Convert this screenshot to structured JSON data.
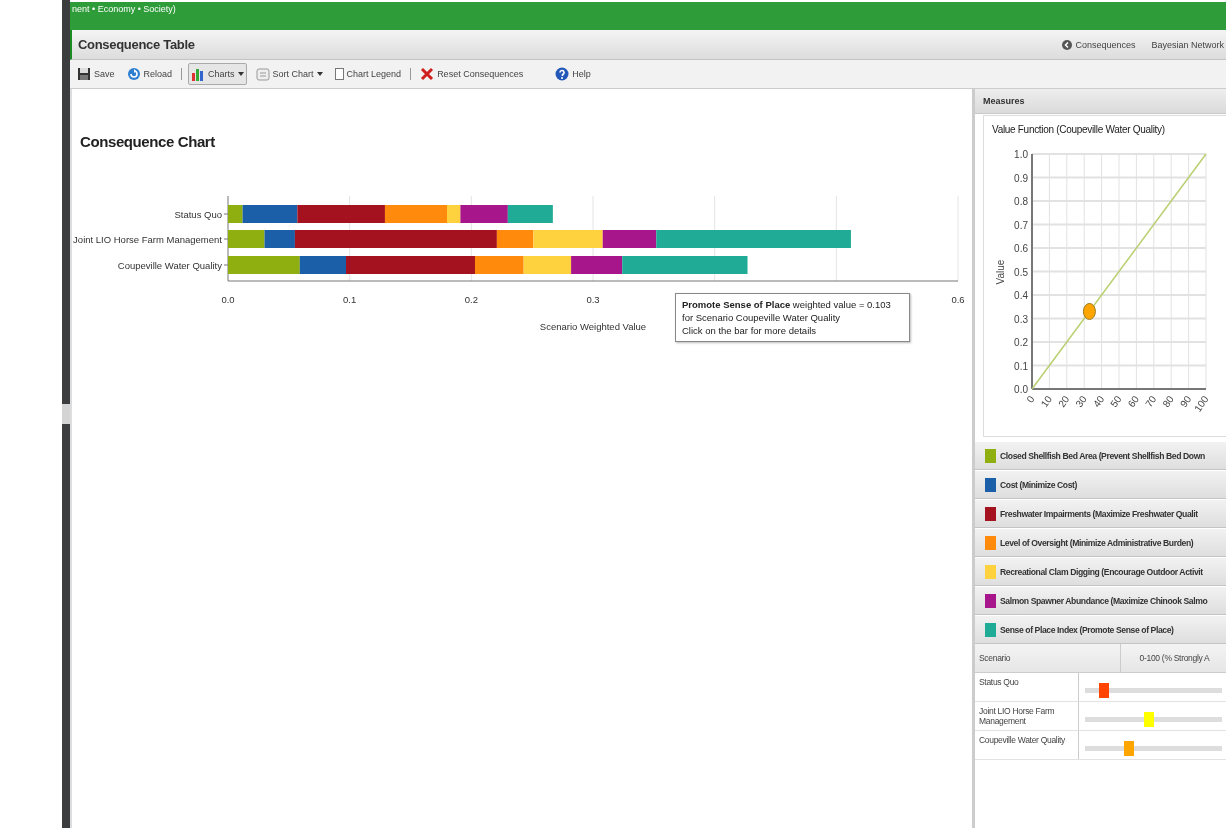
{
  "breadcrumb": "nent • Economy • Society)",
  "header": {
    "title": "Consequence Table",
    "links": [
      {
        "label": "Consequences",
        "kind": "back"
      },
      {
        "label": "Bayesian Network",
        "kind": "plain"
      }
    ]
  },
  "toolbar": [
    {
      "kind": "save",
      "label": "Save"
    },
    {
      "kind": "reload",
      "label": "Reload"
    },
    {
      "kind": "separator"
    },
    {
      "kind": "charts",
      "label": "Charts",
      "pressed": true
    },
    {
      "kind": "sort",
      "label": "Sort Chart",
      "pressed": false
    },
    {
      "kind": "checkbox",
      "label": "Chart Legend",
      "checked": false
    },
    {
      "kind": "separator"
    },
    {
      "kind": "reset",
      "label": "Reset Consequences"
    },
    {
      "kind": "help",
      "label": "Help"
    }
  ],
  "chart_panel": {
    "title": "Consequence Chart",
    "chart_data": {
      "type": "bar",
      "orientation": "horizontal",
      "stacked": true,
      "xlabel": "Scenario Weighted Value",
      "categories": [
        "Status Quo",
        "Joint LIO Horse Farm Management",
        "Coupeville Water Quality"
      ],
      "series": [
        {
          "color": "#8fae0f",
          "values": [
            0.012,
            0.03,
            0.059
          ]
        },
        {
          "color": "#1a5fa8",
          "values": [
            0.045,
            0.025,
            0.038
          ]
        },
        {
          "color": "#a5121f",
          "values": [
            0.072,
            0.166,
            0.106
          ]
        },
        {
          "color": "#ff8a0c",
          "values": [
            0.051,
            0.03,
            0.04
          ]
        },
        {
          "color": "#fed23f",
          "values": [
            0.011,
            0.057,
            0.039
          ]
        },
        {
          "color": "#a8168c",
          "values": [
            0.039,
            0.044,
            0.042
          ]
        },
        {
          "color": "#20ab96",
          "values": [
            0.037,
            0.16,
            0.103
          ]
        }
      ],
      "xlim": [
        0,
        0.6
      ],
      "xticks": [
        {
          "value": 0,
          "label": "0.0"
        },
        {
          "value": 0.1,
          "label": "0.1"
        },
        {
          "value": 0.2,
          "label": "0.2"
        },
        {
          "value": 0.3,
          "label": "0.3"
        },
        {
          "value": 0.6,
          "label": "0.6"
        }
      ],
      "grid": true
    },
    "tooltip": {
      "text": "**Promote Sense of Place** weighted value = 0.103 for Scenario Coupeville Water Quality",
      "note": "Click on the bar for more details"
    }
  },
  "measures_panel": {
    "title": "Measures",
    "value_function": {
      "chart_data": {
        "type": "line",
        "title": "Value Function (Coupeville Water Quality)",
        "ylabel": "Value",
        "x": [
          0,
          33,
          100
        ],
        "grid": true,
        "series": [
          {
            "color": "#b9cf70",
            "values": [
              0,
              null,
              1
            ]
          },
          {
            "color": "#ffa500",
            "marker": true,
            "values": [
              null,
              0.33,
              null
            ]
          }
        ],
        "xlim": [
          0,
          100
        ],
        "ylim": [
          0,
          1
        ],
        "xticks": [
          0,
          10,
          20,
          30,
          40,
          50,
          60,
          70,
          80,
          90,
          100
        ],
        "yticks": [
          {
            "value": 0,
            "label": "0.0"
          },
          {
            "value": 0.1,
            "label": "0.1"
          },
          {
            "value": 0.2,
            "label": "0.2"
          },
          {
            "value": 0.3,
            "label": "0.3"
          },
          {
            "value": 0.4,
            "label": "0.4"
          },
          {
            "value": 0.5,
            "label": "0.5"
          },
          {
            "value": 0.6,
            "label": "0.6"
          },
          {
            "value": 0.7,
            "label": "0.7"
          },
          {
            "value": 0.8,
            "label": "0.8"
          },
          {
            "value": 0.9,
            "label": "0.9"
          },
          {
            "value": 1,
            "label": "1.0"
          }
        ]
      }
    },
    "measures": [
      {
        "label": "Closed Shellfish Bed Area (Prevent Shellfish Bed Down",
        "color": "#8fae0f"
      },
      {
        "label": "Cost (Minimize Cost)",
        "color": "#1a5fa8"
      },
      {
        "label": "Freshwater Impairments (Maximize Freshwater Qualit",
        "color": "#a5121f"
      },
      {
        "label": "Level of Oversight (Minimize Administrative Burden)",
        "color": "#ff8a0c"
      },
      {
        "label": "Recreational Clam Digging (Encourage Outdoor Activit",
        "color": "#fed23f"
      },
      {
        "label": "Salmon Spawner Abundance (Maximize Chinook Salmo",
        "color": "#a8168c"
      },
      {
        "label": "Sense of Place Index (Promote Sense of Place)",
        "color": "#20ab96"
      }
    ],
    "scenario_table": {
      "columns": [
        "Scenario",
        "0-100 (% Strongly A"
      ],
      "rows": [
        {
          "name": "Status Quo",
          "level": 0.14,
          "color": "#ff4500"
        },
        {
          "name": "Joint LIO Horse Farm Management",
          "level": 0.47,
          "color": "#ffff00"
        },
        {
          "name": "Coupeville Water Quality",
          "level": 0.32,
          "color": "#ffa500"
        }
      ]
    }
  }
}
